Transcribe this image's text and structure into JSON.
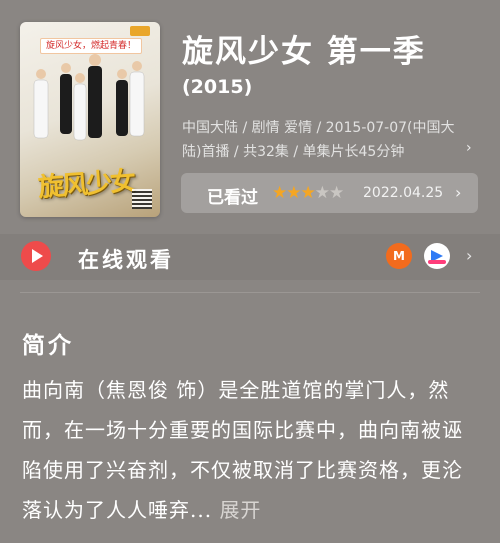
{
  "poster": {
    "banner": "旋风少女，燃起青春！",
    "calligraphy": "旋风少女"
  },
  "title": "旋风少女 第一季",
  "year": "(2015)",
  "meta": "中国大陆 / 剧情 爱情 / 2015-07-07(中国大陆)首播 / 共32集 / 单集片长45分钟",
  "rating": {
    "label": "已看过",
    "stars_total": 5,
    "stars_filled": 3,
    "star_on_color": "#f5a623",
    "date": "2022.04.25"
  },
  "watch": {
    "label": "在线观看",
    "play_color": "#ee4b4b",
    "apps": [
      {
        "name": "mango-tv",
        "glyph": "M",
        "color": "#f26b1d"
      },
      {
        "name": "youku",
        "color": "#2f7bf5"
      }
    ]
  },
  "intro": {
    "heading": "简介",
    "text": "曲向南（焦恩俊 饰）是全胜道馆的掌门人，然而，在一场十分重要的国际比赛中，曲向南被诬陷使用了兴奋剂，不仅被取消了比赛资格，更沦落认为了人人唾弃...",
    "expand": "展开"
  },
  "icons": {
    "chevron": "›"
  }
}
